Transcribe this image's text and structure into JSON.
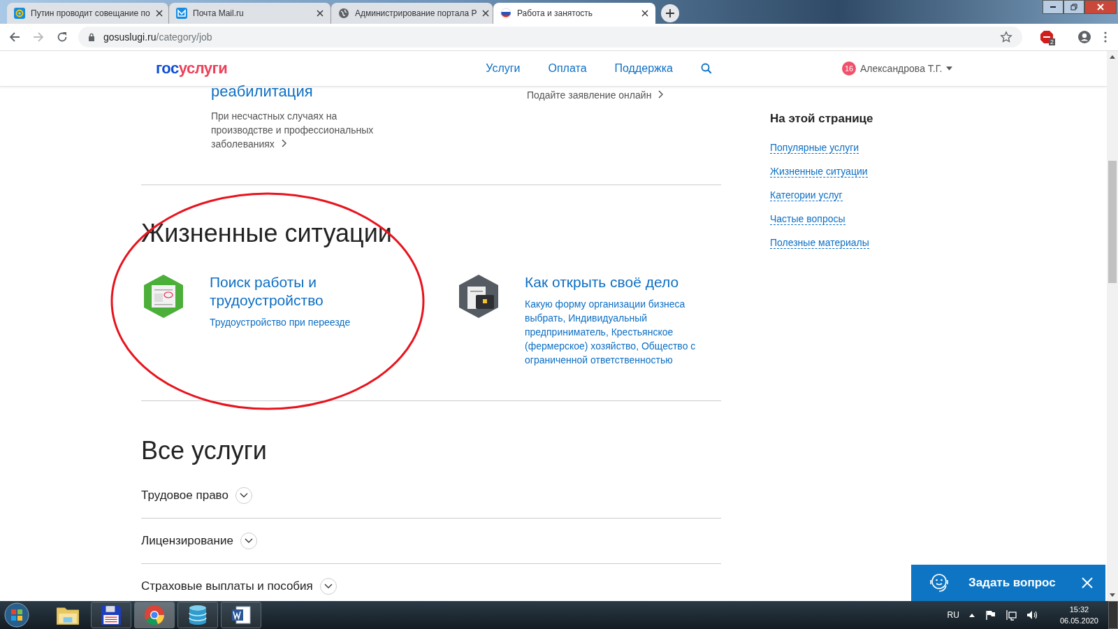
{
  "browser": {
    "tabs": [
      {
        "title": "Путин проводит совещание по",
        "selected": false
      },
      {
        "title": "Почта Mail.ru",
        "selected": false
      },
      {
        "title": "Администрирование портала Р",
        "selected": false
      },
      {
        "title": "Работа и занятость",
        "selected": true
      }
    ],
    "address_host": "gosuslugi.ru",
    "address_path": "/category/job",
    "extension_badge": "2"
  },
  "header": {
    "logo_parts": [
      "гос",
      "услуги"
    ],
    "nav": [
      "Услуги",
      "Оплата",
      "Поддержка"
    ],
    "notifications": "16",
    "user": "Александрова Т.Г."
  },
  "top_cards": [
    {
      "title": "реабилитация",
      "description": "При несчастных случаях на производстве и профессиональных заболеваниях"
    },
    {
      "link": "Подайте заявление онлайн"
    }
  ],
  "life_situations": {
    "heading": "Жизненные ситуации",
    "items": [
      {
        "title": "Поиск работы и трудоустройство",
        "description": "Трудоустройство при переезде"
      },
      {
        "title": "Как открыть своё дело",
        "description": "Какую форму организации бизнеса выбрать, Индивидуальный предприниматель, Крестьянское (фермерское) хозяйство, Общество с ограниченной ответственностью"
      }
    ]
  },
  "all_services": {
    "heading": "Все услуги",
    "items": [
      {
        "label": "Трудовое право",
        "expanded": false
      },
      {
        "label": "Лицензирование",
        "expanded": false
      },
      {
        "label": "Страховые выплаты и пособия",
        "expanded": false
      }
    ]
  },
  "sidebar": {
    "heading": "На этой странице",
    "links": [
      "Популярные услуги",
      "Жизненные ситуации",
      "Категории услуг",
      "Частые вопросы",
      "Полезные материалы"
    ]
  },
  "chat": {
    "label": "Задать вопрос"
  },
  "taskbar": {
    "apps": [
      {
        "running": false,
        "selected": false
      },
      {
        "running": true,
        "selected": false
      },
      {
        "running": true,
        "selected": true
      },
      {
        "running": true,
        "selected": false
      },
      {
        "running": true,
        "selected": false
      }
    ],
    "language": "RU",
    "time": "15:32",
    "date": "06.05.2020"
  }
}
